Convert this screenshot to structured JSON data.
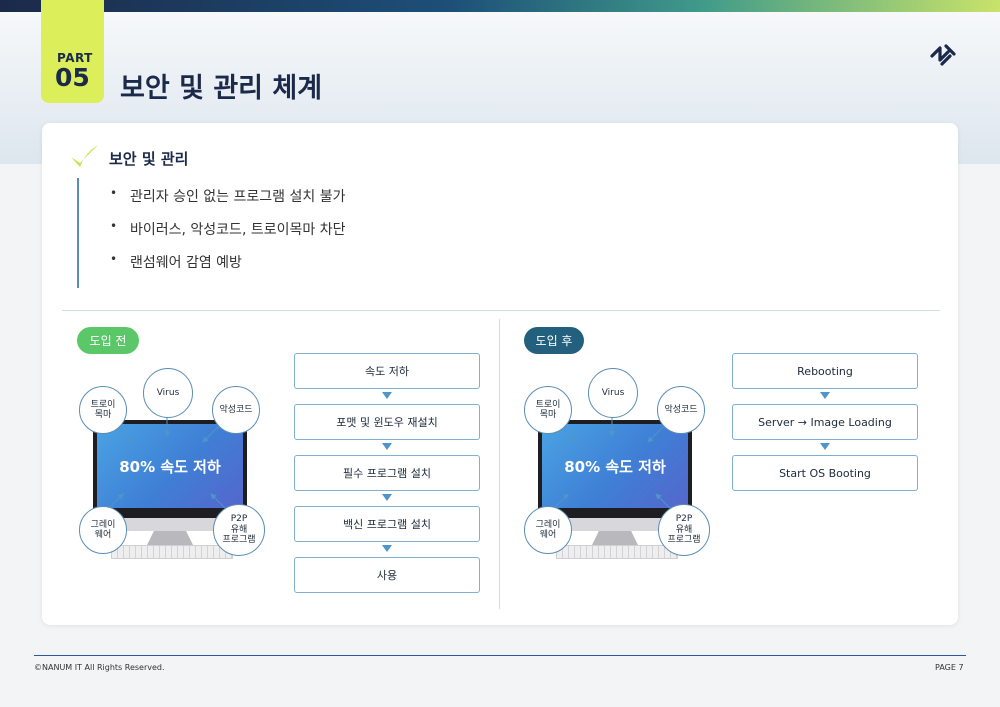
{
  "header": {
    "part_label": "PART",
    "part_number": "05",
    "title": "보안 및 관리 체계"
  },
  "section": {
    "title": "보안 및 관리",
    "bullets": [
      "관리자 승인 없는 프로그램 설치 불가",
      "바이러스, 악성코드, 트로이목마 차단",
      "랜섬웨어 감염 예방"
    ],
    "bullet_marker": "•"
  },
  "before": {
    "label": "도입 전",
    "screen_text": "80% 속도 저하",
    "threats": {
      "trojan": "트로이\n목마",
      "virus": "Virus",
      "malware": "악성코드",
      "grayware": "그레이\n웨어",
      "p2p": "P2P\n유해\n프로그램"
    },
    "steps": [
      "속도 저하",
      "포맷 및 윈도우 재설치",
      "필수 프로그램 설치",
      "백신 프로그램 설치",
      "사용"
    ]
  },
  "after": {
    "label": "도입 후",
    "screen_text": "80% 속도 저하",
    "threats": {
      "trojan": "트로이\n목마",
      "virus": "Virus",
      "malware": "악성코드",
      "grayware": "그레이\n웨어",
      "p2p": "P2P\n유해\n프로그램"
    },
    "steps": [
      "Rebooting",
      "Server → Image Loading",
      "Start OS Booting"
    ]
  },
  "footer": {
    "copyright": "©NANUM IT All Rights Reserved.",
    "page": "PAGE 7"
  },
  "colors": {
    "accent_lime": "#dcee5a",
    "navy": "#1b2a4a",
    "green_pill": "#5cc768",
    "teal_pill": "#23607e",
    "flow_border": "#7fb0d1",
    "arrow_blue": "#4f95c9"
  },
  "icons": {
    "logo": "nanum-logo-icon",
    "check": "checkmark-icon"
  }
}
